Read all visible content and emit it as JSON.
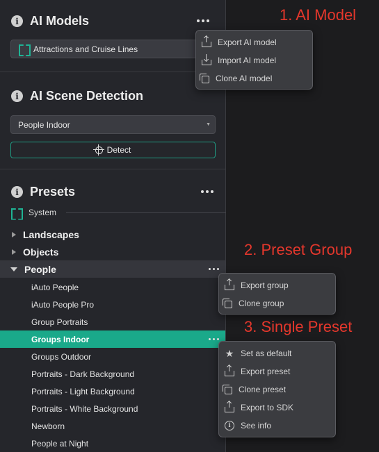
{
  "panel": {
    "ai_models": {
      "title": "AI Models",
      "info_icon": "i",
      "selected_model": "Attractions and Cruise Lines"
    },
    "scene_detection": {
      "title": "AI Scene Detection",
      "info_icon": "i",
      "selected_scene": "People Indoor",
      "detect_label": "Detect"
    },
    "presets": {
      "title": "Presets",
      "info_icon": "i",
      "system_label": "System",
      "groups": [
        {
          "label": "Landscapes",
          "expanded": false
        },
        {
          "label": "Objects",
          "expanded": false
        },
        {
          "label": "People",
          "expanded": true
        }
      ],
      "people_presets": [
        "iAuto People",
        "iAuto People Pro",
        "Group Portraits",
        "Groups Indoor",
        "Groups Outdoor",
        "Portraits - Dark Background",
        "Portraits - Light Background",
        "Portraits - White Background",
        "Newborn",
        "People at Night"
      ],
      "selected_preset": "Groups Indoor"
    }
  },
  "menus": {
    "ai_model_menu": [
      {
        "label": "Export AI model",
        "icon": "export-icon"
      },
      {
        "label": "Import AI model",
        "icon": "import-icon"
      },
      {
        "label": "Clone AI model",
        "icon": "clone-icon"
      }
    ],
    "group_menu": [
      {
        "label": "Export group",
        "icon": "export-icon"
      },
      {
        "label": "Clone group",
        "icon": "clone-icon"
      }
    ],
    "preset_menu": [
      {
        "label": "Set as default",
        "icon": "star-icon"
      },
      {
        "label": "Export preset",
        "icon": "export-icon"
      },
      {
        "label": "Clone preset",
        "icon": "clone-icon"
      },
      {
        "label": "Export to SDK",
        "icon": "export-icon"
      },
      {
        "label": "See info",
        "icon": "info-icon"
      }
    ]
  },
  "annotations": {
    "a1": "1. AI Model",
    "a2": "2. Preset Group",
    "a3": "3. Single Preset"
  },
  "colors": {
    "accent": "#1aa98a",
    "annotation": "#e5372c",
    "panel_bg": "#25262b"
  }
}
